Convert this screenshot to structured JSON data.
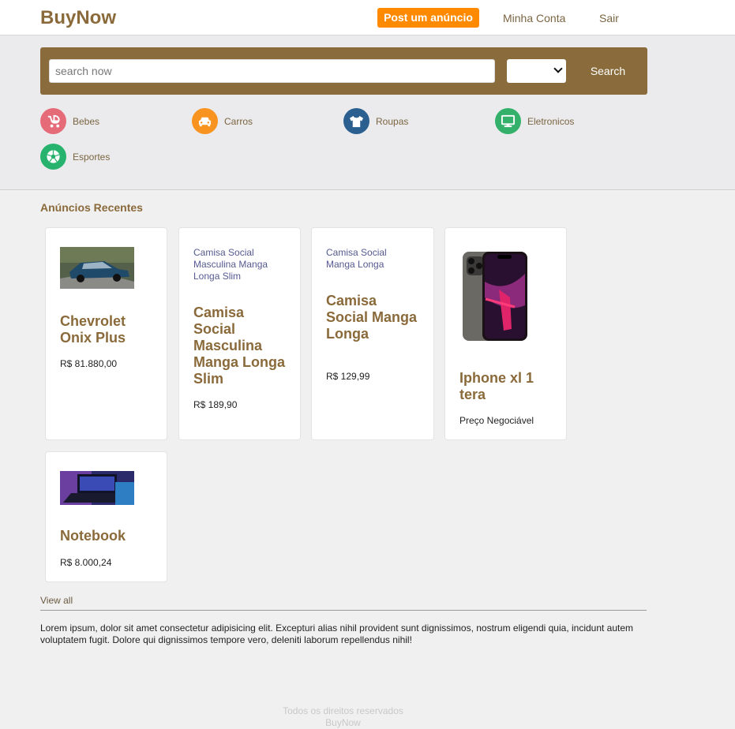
{
  "header": {
    "logo": "BuyNow",
    "post_label": "Post um anúncio",
    "account_label": "Minha Conta",
    "logout_label": "Sair"
  },
  "search": {
    "placeholder": "search now",
    "select_value": "",
    "button_label": "Search"
  },
  "categories": [
    {
      "label": "Bebes",
      "icon": "baby-carriage-icon",
      "color": "#e56b78"
    },
    {
      "label": "Carros",
      "icon": "car-icon",
      "color": "#f7931e"
    },
    {
      "label": "Roupas",
      "icon": "tshirt-icon",
      "color": "#2a5f8f"
    },
    {
      "label": "Eletronicos",
      "icon": "monitor-icon",
      "color": "#33b06a"
    },
    {
      "label": "Esportes",
      "icon": "soccer-ball-icon",
      "color": "#27b36d"
    }
  ],
  "recent": {
    "title": "Anúncios Recentes",
    "items": [
      {
        "title": "Chevrolet Onix Plus",
        "price": "R$ 81.880,00",
        "image": "car-photo"
      },
      {
        "title": "Camisa Social Masculina Manga Longa Slim",
        "price": "R$ 189,90",
        "image_alt": "Camisa Social Masculina Manga Longa Slim"
      },
      {
        "title": "Camisa Social Manga Longa",
        "price": "R$ 129,99",
        "image_alt": "Camisa Social Manga Longa"
      },
      {
        "title": "Iphone xl 1 tera",
        "price": "Preço Negociável",
        "image": "phone-photo"
      },
      {
        "title": "Notebook",
        "price": "R$ 8.000,24",
        "image": "laptop-photo"
      }
    ],
    "view_all": "View all"
  },
  "about": "Lorem ipsum, dolor sit amet consectetur adipisicing elit. Excepturi alias nihil provident sunt dignissimos, nostrum eligendi quia, incidunt autem voluptatem fugit. Dolore qui dignissimos tempore vero, deleniti laborum repellendus nihil!",
  "footer": {
    "line1": "Todos os direitos reservados",
    "line2": "BuyNow"
  },
  "colors": {
    "brand": "#8a6a3a",
    "accent": "#ff8a00"
  }
}
